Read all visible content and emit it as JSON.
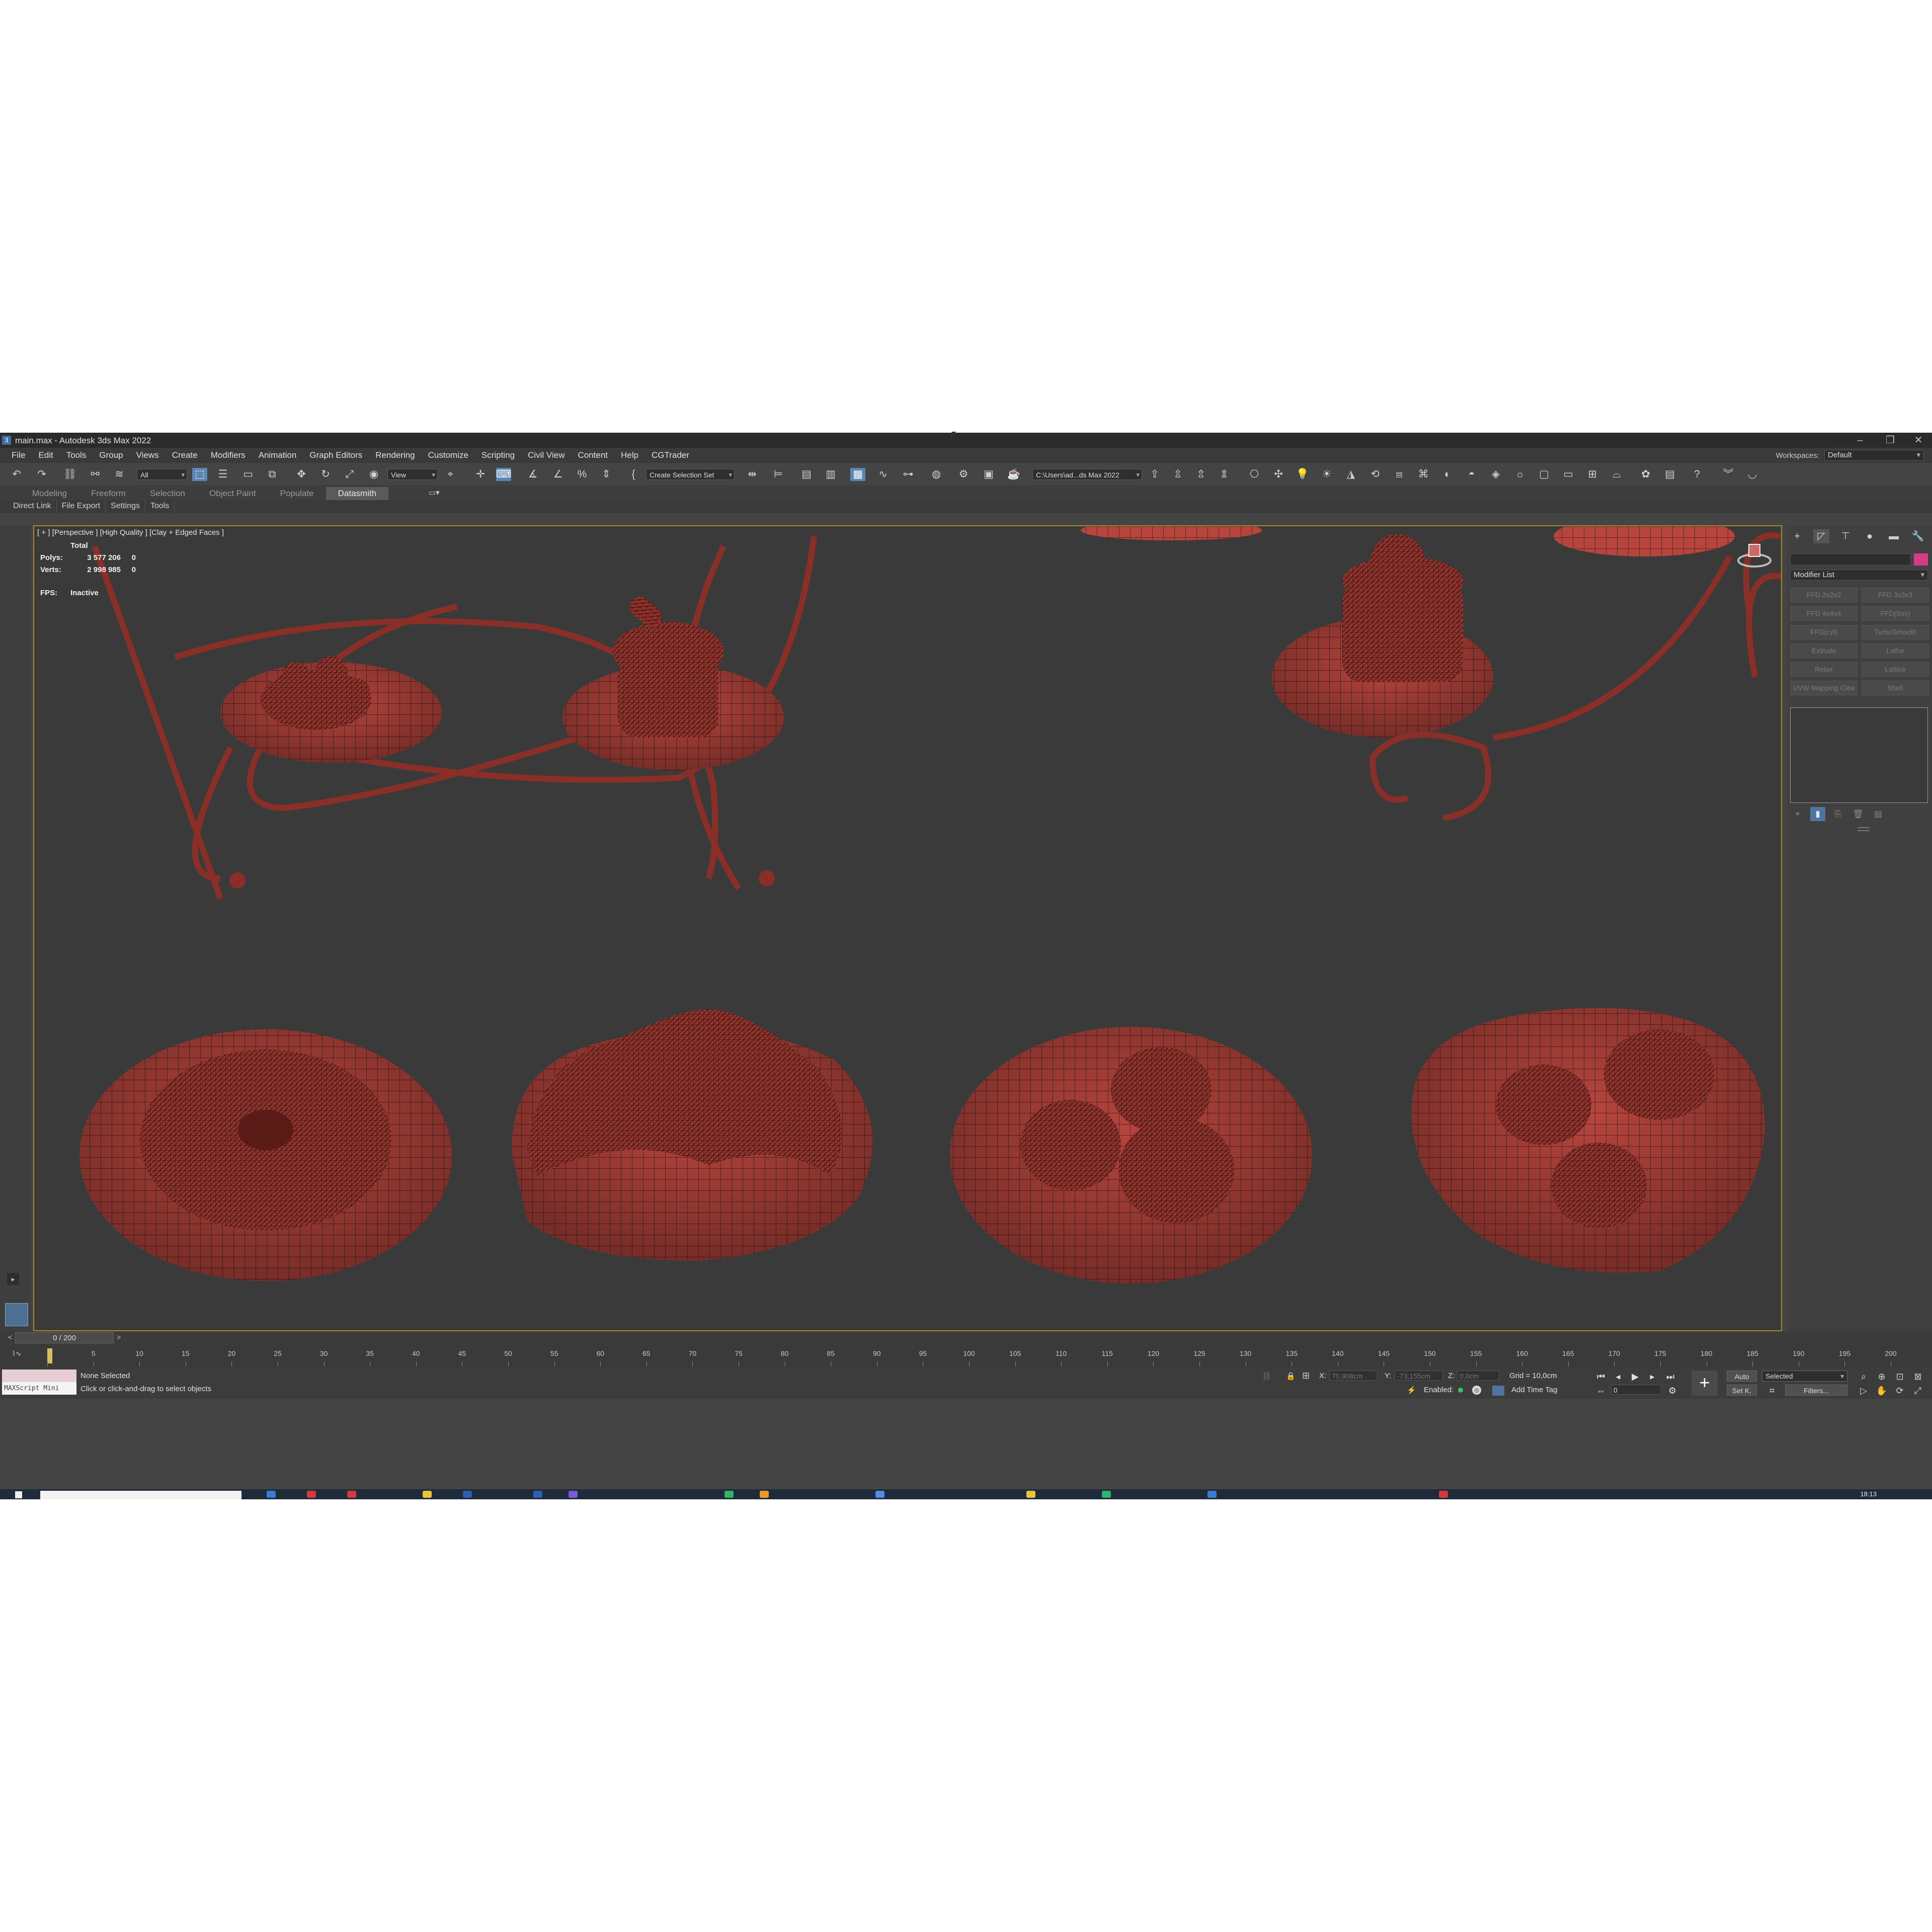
{
  "window": {
    "title": "main.max - Autodesk 3ds Max 2022",
    "app_icon": "3ds-max-icon",
    "controls": [
      "minimize-icon",
      "restore-icon",
      "close-icon"
    ]
  },
  "menu": {
    "items": [
      "File",
      "Edit",
      "Tools",
      "Group",
      "Views",
      "Create",
      "Modifiers",
      "Animation",
      "Graph Editors",
      "Rendering",
      "Customize",
      "Scripting",
      "Civil View",
      "Content",
      "Help",
      "CGTrader"
    ],
    "workspaces_label": "Workspaces:",
    "workspaces_value": "Default"
  },
  "toolbar": {
    "selection_filter": "All",
    "reference_coord": "View",
    "named_selection": "Create Selection Set",
    "project_path": "C:\\Users\\ad...ds Max 2022"
  },
  "ribbon": {
    "tabs": [
      "Modeling",
      "Freeform",
      "Selection",
      "Object Paint",
      "Populate",
      "Datasmith"
    ],
    "active_tab": "Datasmith"
  },
  "subtabs": [
    "Direct Link",
    "File Export",
    "Settings",
    "Tools"
  ],
  "viewport": {
    "label": "[ + ] [Perspective ] [High Quality ] [Clay + Edged Faces ]",
    "stats": {
      "total_label": "Total",
      "polys_label": "Polys:",
      "polys_total": "3 577 206",
      "polys_sel": "0",
      "verts_label": "Verts:",
      "verts_total": "2 998 985",
      "verts_sel": "0",
      "fps_label": "FPS:",
      "fps_value": "Inactive"
    },
    "objects": [
      "donut-plate",
      "croissant-plate",
      "macarons-plate",
      "cakes-wavy-plate",
      "tart-plate",
      "cupcake-plate",
      "layer-cake-plate",
      "wire-stand"
    ],
    "mesh_color": "#b8453d",
    "wire_color": "#3a0f0c"
  },
  "command_panel": {
    "tabs": [
      "create-icon",
      "modify-icon",
      "hierarchy-icon",
      "motion-icon",
      "display-icon",
      "utilities-icon"
    ],
    "modifier_list_label": "Modifier List",
    "modifier_buttons": [
      "FFD 2x2x2",
      "FFD 3x3x3",
      "FFD 4x4x4",
      "FFD(box)",
      "FFD(cyl)",
      "TurboSmooth",
      "Extrude",
      "Lathe",
      "Relax",
      "Lattice",
      "UVW Mapping Clea",
      "Shell"
    ],
    "object_color": "#d43b8a"
  },
  "timeline": {
    "frame_display": "0 / 200",
    "ticks": [
      0,
      5,
      10,
      15,
      20,
      25,
      30,
      35,
      40,
      45,
      50,
      55,
      60,
      65,
      70,
      75,
      80,
      85,
      90,
      95,
      100,
      105,
      110,
      115,
      120,
      125,
      130,
      135,
      140,
      145,
      150,
      155,
      160,
      165,
      170,
      175,
      180,
      185,
      190,
      195,
      200
    ],
    "max_frame": 200
  },
  "status": {
    "maxscript_label": "MAXScript Mini",
    "selection": "None Selected",
    "prompt": "Click or click-and-drag to select objects",
    "x_label": "X:",
    "x_value": "70,908cm",
    "y_label": "Y:",
    "y_value": "-73,155cm",
    "z_label": "Z:",
    "z_value": "0,0cm",
    "grid": "Grid = 10,0cm",
    "enabled": "Enabled:",
    "add_time_tag": "Add Time Tag",
    "auto": "Auto",
    "set_key": "Set K.",
    "selected": "Selected",
    "filters": "Filters...",
    "frame_field": "0"
  },
  "taskbar": {
    "clock": "18:13"
  }
}
